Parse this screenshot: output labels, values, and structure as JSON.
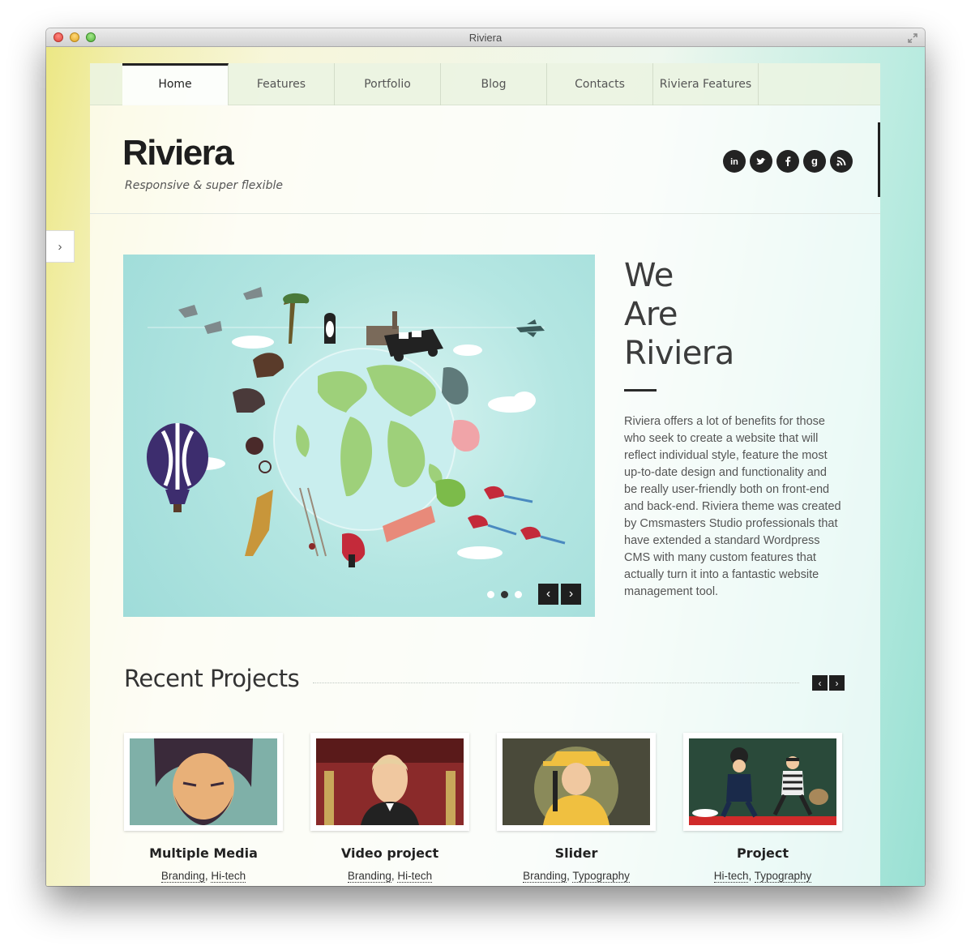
{
  "window": {
    "title": "Riviera"
  },
  "nav": {
    "items": [
      {
        "label": "Home",
        "active": true
      },
      {
        "label": "Features"
      },
      {
        "label": "Portfolio"
      },
      {
        "label": "Blog"
      },
      {
        "label": "Contacts"
      },
      {
        "label": "Riviera Features"
      }
    ]
  },
  "header": {
    "logo": "Riviera",
    "tagline": "Responsive & super flexible",
    "socials": [
      "linkedin-icon",
      "twitter-icon",
      "facebook-icon",
      "google-icon",
      "rss-icon"
    ]
  },
  "slider": {
    "dot_count": 3,
    "active_dot": 2
  },
  "hero": {
    "title_lines": [
      "We",
      "Are",
      "Riviera"
    ],
    "text": "Riviera offers a lot of benefits for those who seek to create a website that will reflect individual style, feature the most up-to-date design and functionality and be really user-friendly both on front-end and back-end. Riviera theme was created by Cmsmasters Studio professionals that have extended a standard Wordpress CMS with many custom features that actually turn it into a fantastic website management tool."
  },
  "recent_projects": {
    "title": "Recent Projects",
    "items": [
      {
        "title": "Multiple Media",
        "tags": [
          "Branding",
          "Hi-tech"
        ]
      },
      {
        "title": "Video project",
        "tags": [
          "Branding",
          "Hi-tech"
        ]
      },
      {
        "title": "Slider",
        "tags": [
          "Branding",
          "Typography"
        ]
      },
      {
        "title": "Project",
        "tags": [
          "Hi-tech",
          "Typography"
        ]
      }
    ]
  },
  "colors": {
    "accent_dark": "#1f1f1f",
    "slide_bg": "#a8e0dc",
    "globe_ocean": "#c9eeee",
    "land": "#9ed07a"
  }
}
